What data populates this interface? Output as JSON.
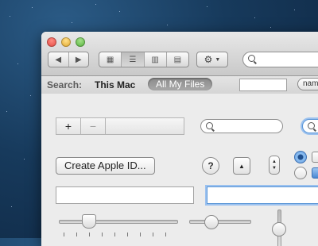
{
  "window": {
    "controls": [
      "close",
      "minimize",
      "zoom"
    ]
  },
  "toolbar": {
    "back_icon": "back-arrow-icon",
    "forward_icon": "forward-arrow-icon",
    "view_modes": [
      "icon-view",
      "list-view",
      "column-view",
      "coverflow-view"
    ],
    "active_view": "list-view",
    "action_icon": "gear-icon"
  },
  "scope_bar": {
    "label": "Search:",
    "this_mac": "This Mac",
    "all_my_files": "All My Files",
    "name_button": "nam"
  },
  "controls": {
    "add_symbol": "+",
    "remove_symbol": "−",
    "create_apple_id": "Create Apple ID...",
    "help_symbol": "?",
    "disclosure_symbol": "▲",
    "stepper_up": "▲",
    "stepper_down": "▼",
    "radio_selected": true,
    "checkbox_checked": true
  },
  "colors": {
    "desktop": "#173a5c",
    "focus_ring": "#9cc2ef",
    "scope_selected": "#9a9a9a",
    "close": "#e0443e",
    "minimize": "#dea123",
    "zoom": "#4fae35"
  }
}
